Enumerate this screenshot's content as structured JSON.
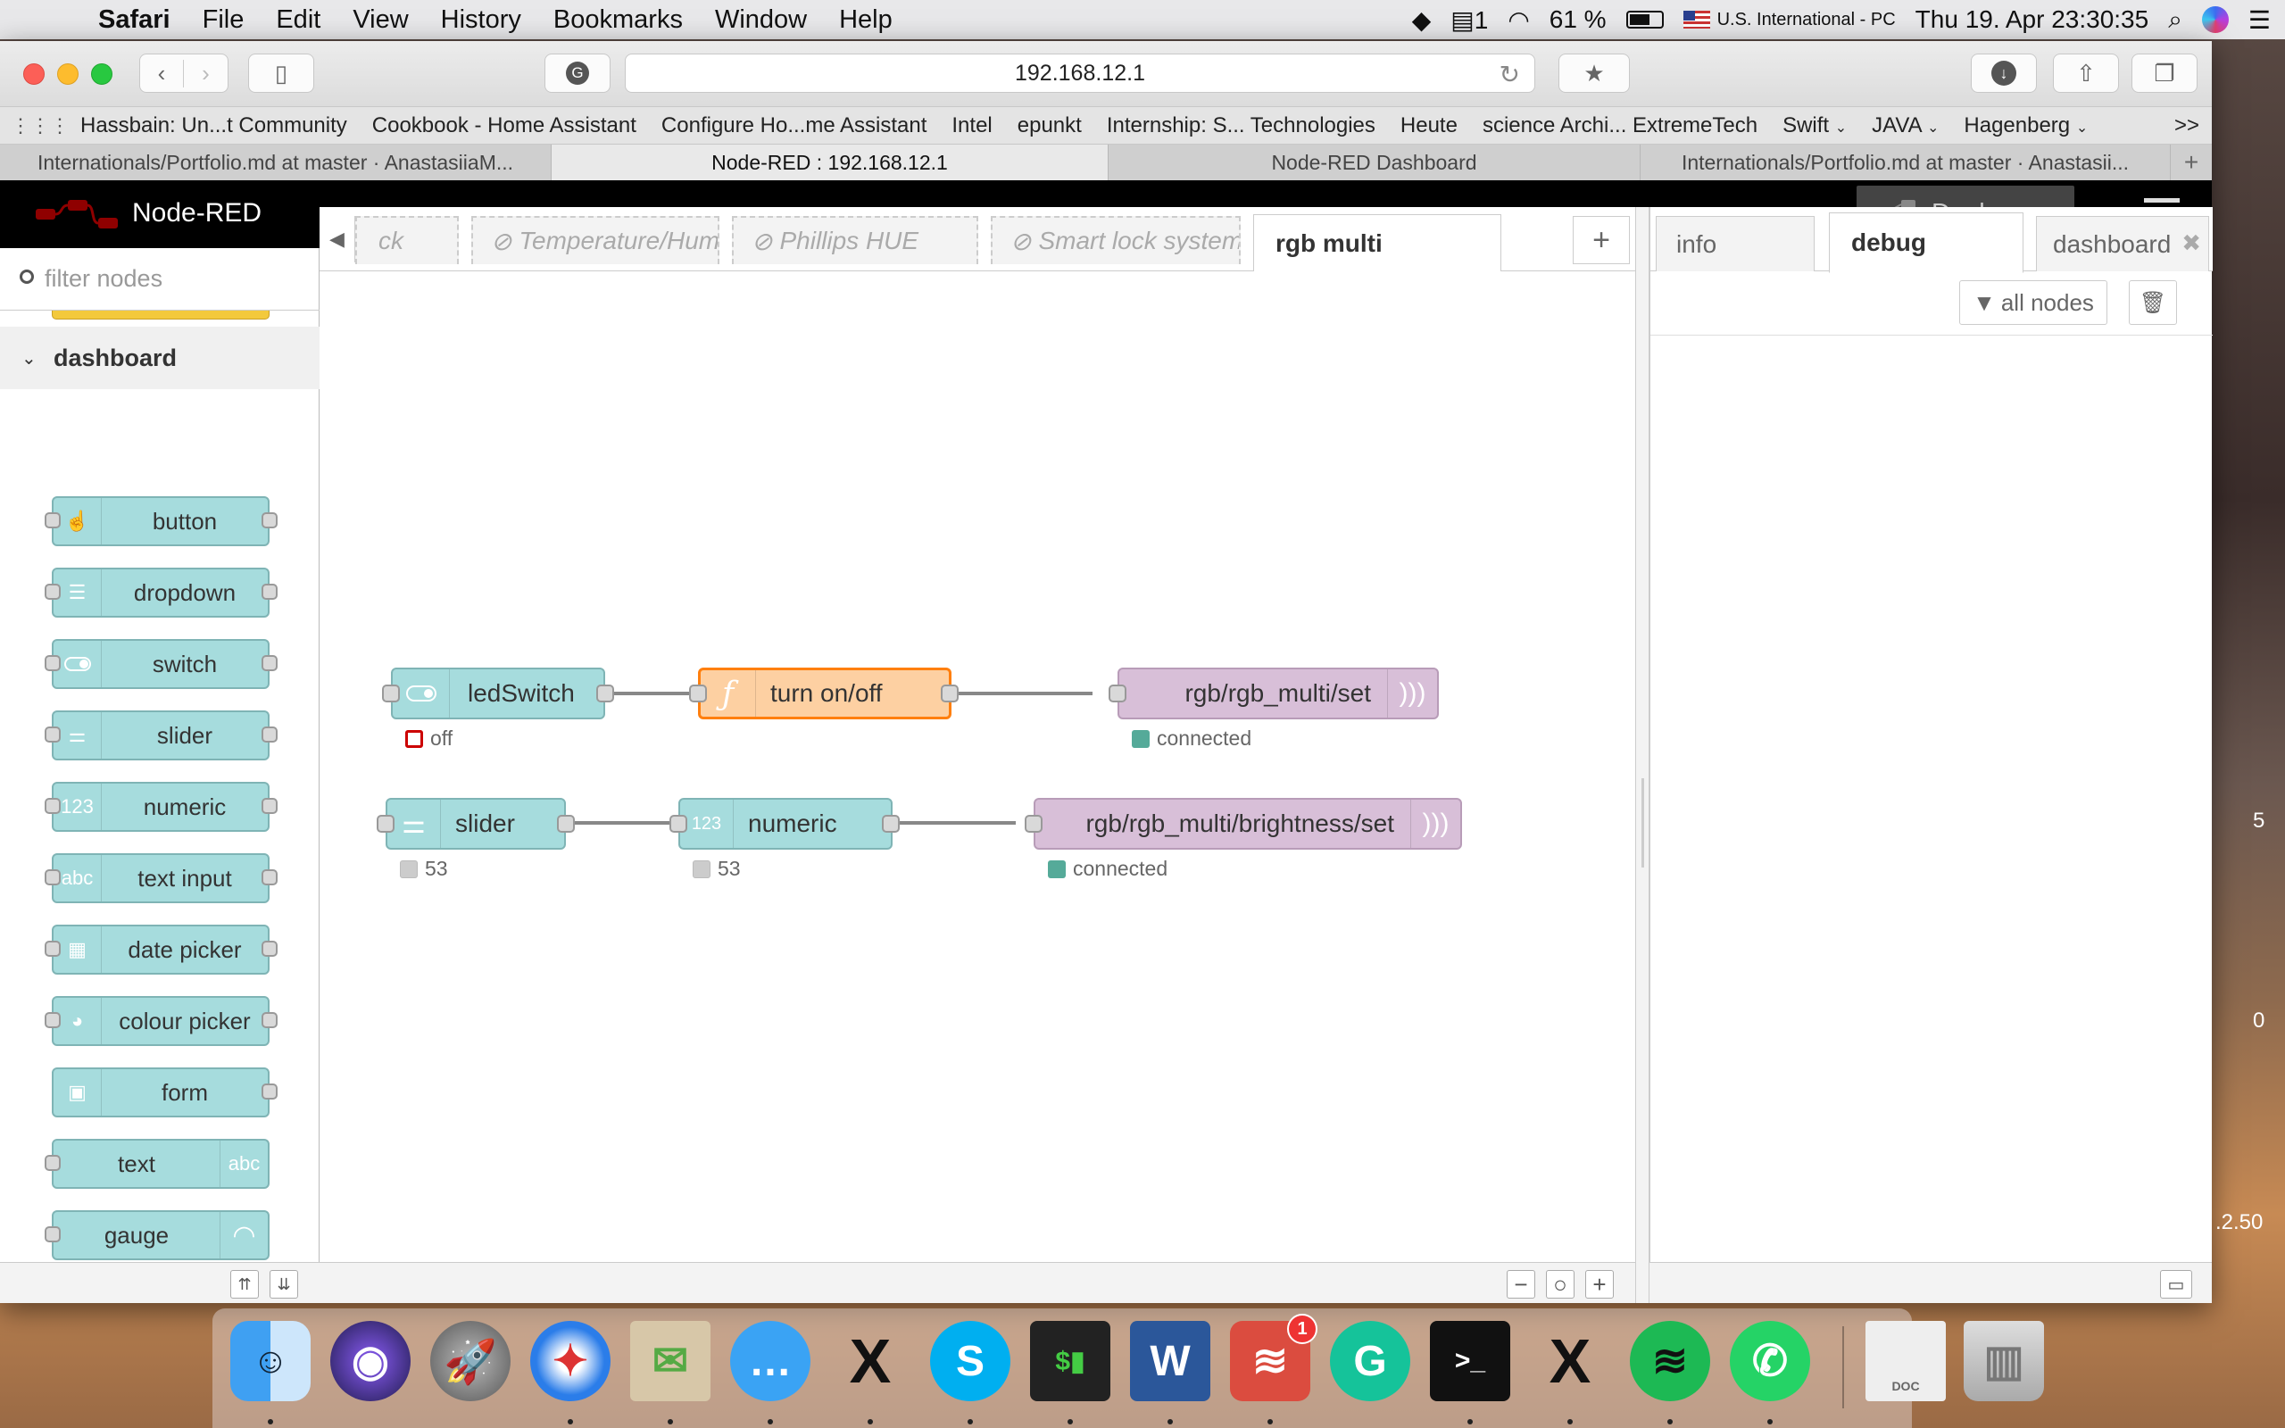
{
  "menubar": {
    "app": "Safari",
    "items": [
      "File",
      "Edit",
      "View",
      "History",
      "Bookmarks",
      "Window",
      "Help"
    ],
    "right": {
      "notifications": "1",
      "battery": "61 %",
      "input_source": "U.S. International - PC",
      "datetime": "Thu 19. Apr  23:30:35"
    }
  },
  "browser": {
    "url": "192.168.12.1",
    "bookmarks": [
      "Hassbain: Un...t Community",
      "Cookbook - Home Assistant",
      "Configure Ho...me Assistant",
      "Intel",
      "epunkt",
      "Internship: S... Technologies",
      "Heute",
      "science Archi... ExtremeTech",
      "Swift",
      "JAVA",
      "Hagenberg"
    ],
    "bookmarks_more": ">>",
    "tabs": [
      {
        "label": "Internationals/Portfolio.md at master · AnastasiiaM..."
      },
      {
        "label": "Node-RED : 192.168.12.1"
      },
      {
        "label": "Node-RED Dashboard"
      },
      {
        "label": "Internationals/Portfolio.md at master · Anastasii..."
      }
    ],
    "new_tab": "+"
  },
  "nodered": {
    "title": "Node-RED",
    "deploy": "Deploy",
    "palette": {
      "filter_placeholder": "filter nodes",
      "category": "dashboard",
      "nodes": [
        {
          "label": "button",
          "icon": "hand-pointer-icon"
        },
        {
          "label": "dropdown",
          "icon": "list-icon"
        },
        {
          "label": "switch",
          "icon": "toggle-icon"
        },
        {
          "label": "slider",
          "icon": "sliders-icon"
        },
        {
          "label": "numeric",
          "icon": "numeric-123-icon",
          "glyph": "123"
        },
        {
          "label": "text input",
          "icon": "abc-icon",
          "glyph": "abc"
        },
        {
          "label": "date picker",
          "icon": "calendar-icon"
        },
        {
          "label": "colour picker",
          "icon": "palette-icon"
        },
        {
          "label": "form",
          "icon": "form-icon"
        },
        {
          "label": "text",
          "icon": "abc-icon",
          "glyph": "abc"
        },
        {
          "label": "gauge",
          "icon": "gauge-icon"
        }
      ]
    },
    "workspace_tabs": [
      {
        "label": "ck",
        "disabled": true
      },
      {
        "label": "Temperature/Hum",
        "disabled": true
      },
      {
        "label": "Phillips HUE",
        "disabled": true
      },
      {
        "label": "Smart lock system",
        "disabled": true
      },
      {
        "label": "rgb multi",
        "disabled": false
      }
    ],
    "flow": {
      "nodes": [
        {
          "id": "ledSwitch",
          "label": "ledSwitch",
          "status": "off"
        },
        {
          "id": "turnonoff",
          "label": "turn on/off",
          "glyph": "ƒ"
        },
        {
          "id": "mqtt1",
          "label": "rgb/rgb_multi/set",
          "status": "connected"
        },
        {
          "id": "slider",
          "label": "slider",
          "status": "53"
        },
        {
          "id": "numeric",
          "label": "numeric",
          "status": "53",
          "glyph": "123"
        },
        {
          "id": "mqtt2",
          "label": "rgb/rgb_multi/brightness/set",
          "status": "connected"
        }
      ]
    },
    "sidebar": {
      "tabs": [
        "info",
        "debug",
        "dashboard"
      ],
      "active_tab": "debug",
      "filter_button": "all nodes"
    },
    "colors": {
      "dashboard_node": "#a6dcdd",
      "function_node": "#fdd0a2",
      "mqtt_node": "#d8bfd8",
      "status_connected": "#5a9",
      "status_off": "#c00"
    }
  },
  "desktop": {
    "edge_fragments": [
      "5",
      "0",
      ".2.50"
    ]
  },
  "dock": {
    "apps": [
      {
        "name": "Finder",
        "icon": "finder-icon"
      },
      {
        "name": "Siri",
        "icon": "siri-icon"
      },
      {
        "name": "Launchpad",
        "icon": "rocket-icon"
      },
      {
        "name": "Safari",
        "icon": "compass-icon"
      },
      {
        "name": "Mail",
        "icon": "eagle-stamp-icon"
      },
      {
        "name": "Messages",
        "icon": "chat-bubble-icon"
      },
      {
        "name": "XQuartz",
        "icon": "x-icon"
      },
      {
        "name": "Skype",
        "icon": "skype-icon"
      },
      {
        "name": "Terminal",
        "icon": "terminal-icon",
        "glyph": "$▮"
      },
      {
        "name": "Word",
        "icon": "word-icon",
        "glyph": "W"
      },
      {
        "name": "Todoist",
        "icon": "todoist-icon",
        "badge": "1"
      },
      {
        "name": "Grammarly",
        "icon": "grammarly-icon"
      },
      {
        "name": "Terminal 2",
        "icon": "terminal-icon",
        "glyph": ">_"
      },
      {
        "name": "XQuartz 2",
        "icon": "x-icon"
      },
      {
        "name": "Spotify",
        "icon": "spotify-icon"
      },
      {
        "name": "WhatsApp",
        "icon": "whatsapp-icon"
      },
      {
        "name": "Document",
        "icon": "document-icon",
        "glyph": "DOC"
      },
      {
        "name": "Trash",
        "icon": "trash-icon"
      }
    ]
  }
}
